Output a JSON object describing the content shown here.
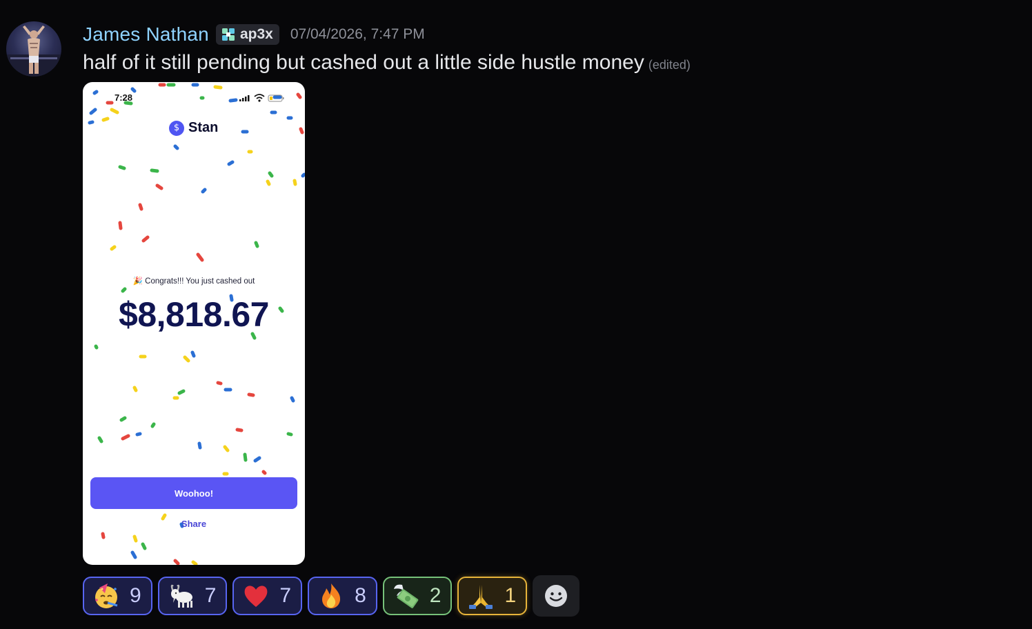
{
  "author": {
    "username": "James Nathan",
    "tag": "ap3x",
    "timestamp": "07/04/2026, 7:47 PM"
  },
  "message": {
    "text": "half of it still pending but cashed out a little side hustle money",
    "edited_label": "(edited)"
  },
  "attachment": {
    "status_time": "7:28",
    "brand": "Stan",
    "brand_icon": "$",
    "congrats": "🎉 Congrats!!! You just cashed out",
    "amount": "$8,818.67",
    "primary_button": "Woohoo!",
    "secondary_link": "Share",
    "accent_color": "#5a55f4"
  },
  "reactions": [
    {
      "emoji": "party-face",
      "count": "9",
      "style": "blue"
    },
    {
      "emoji": "goat",
      "count": "7",
      "style": "blue"
    },
    {
      "emoji": "red-heart",
      "count": "7",
      "style": "blue"
    },
    {
      "emoji": "fire",
      "count": "8",
      "style": "blue"
    },
    {
      "emoji": "money-with-wings",
      "count": "2",
      "style": "green"
    },
    {
      "emoji": "folded-hands",
      "count": "1",
      "style": "gold"
    }
  ],
  "add_reaction_icon": "smiley-add-icon"
}
